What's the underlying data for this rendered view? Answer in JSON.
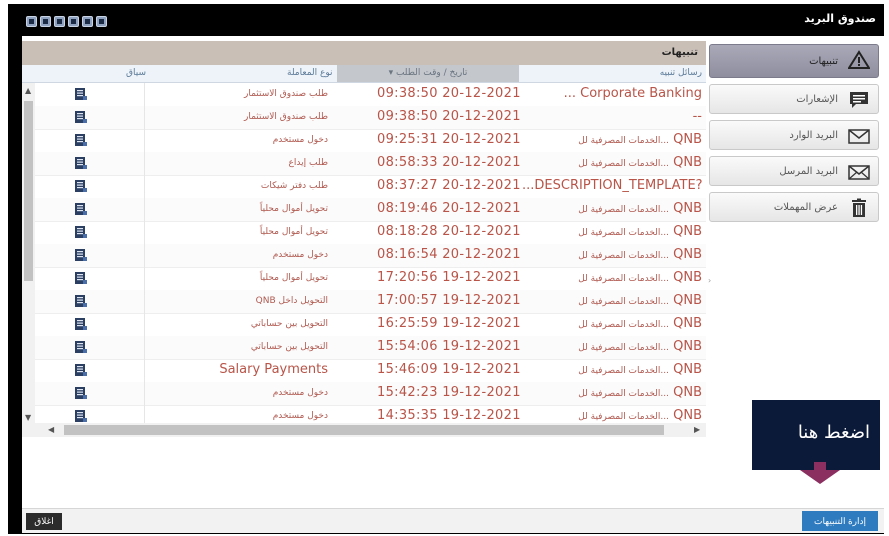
{
  "window": {
    "title": "صندوق البريد",
    "toolbar_icons": [
      "close-icon",
      "print-icon",
      "refresh-icon",
      "calculator-icon",
      "help-icon",
      "settings-icon"
    ]
  },
  "sidebar": {
    "items": [
      {
        "label": "تنبيهات",
        "icon": "warning-icon",
        "active": true
      },
      {
        "label": "الإشعارات",
        "icon": "speech-bubble-icon",
        "active": false
      },
      {
        "label": "البريد الوارد",
        "icon": "envelope-icon",
        "active": false
      },
      {
        "label": "البريد المرسل",
        "icon": "envelope-send-icon",
        "active": false
      },
      {
        "label": "عرض المهملات",
        "icon": "trash-icon",
        "active": false
      }
    ]
  },
  "panel": {
    "title": "تنبيهات",
    "columns": {
      "message": "رسائل تنبيه",
      "date": "تاريخ / وقت الطلب",
      "type": "نوع المعاملة",
      "context": "سياق"
    },
    "rows": [
      {
        "message": "Corporate Banking",
        "message_prefix": "...",
        "message_ar": "",
        "date": "09:38:50 20-12-2021",
        "type": "طلب صندوق الاستثمار",
        "type_big": false
      },
      {
        "message": "--",
        "message_prefix": "",
        "message_ar": "",
        "date": "09:38:50 20-12-2021",
        "type": "طلب صندوق الاستثمار",
        "type_big": false
      },
      {
        "message": "QNB",
        "message_prefix": "",
        "message_ar": "الخدمات المصرفية لل...",
        "date": "09:25:31 20-12-2021",
        "type": "دخول مستخدم",
        "type_big": false
      },
      {
        "message": "QNB",
        "message_prefix": "",
        "message_ar": "الخدمات المصرفية لل...",
        "date": "08:58:33 20-12-2021",
        "type": "طلب إيداع",
        "type_big": false
      },
      {
        "message": "...DESCRIPTION_TEMPLATE?",
        "message_prefix": "",
        "message_ar": "",
        "date": "08:37:27 20-12-2021",
        "type": "طلب دفتر شيكات",
        "type_big": false
      },
      {
        "message": "QNB",
        "message_prefix": "",
        "message_ar": "الخدمات المصرفية لل...",
        "date": "08:19:46 20-12-2021",
        "type": "تحويل أموال محلياً",
        "type_big": false
      },
      {
        "message": "QNB",
        "message_prefix": "",
        "message_ar": "الخدمات المصرفية لل...",
        "date": "08:18:28 20-12-2021",
        "type": "تحويل أموال محلياً",
        "type_big": false
      },
      {
        "message": "QNB",
        "message_prefix": "",
        "message_ar": "الخدمات المصرفية لل...",
        "date": "08:16:54 20-12-2021",
        "type": "دخول مستخدم",
        "type_big": false
      },
      {
        "message": "QNB",
        "message_prefix": "",
        "message_ar": "الخدمات المصرفية لل...",
        "date": "17:20:56 19-12-2021",
        "type": "تحويل أموال محلياً",
        "type_big": false
      },
      {
        "message": "QNB",
        "message_prefix": "",
        "message_ar": "الخدمات المصرفية لل...",
        "date": "17:00:57 19-12-2021",
        "type": "التحويل داخل QNB",
        "type_big": false
      },
      {
        "message": "QNB",
        "message_prefix": "",
        "message_ar": "الخدمات المصرفية لل...",
        "date": "16:25:59 19-12-2021",
        "type": "التحويل بين حساباتي",
        "type_big": false
      },
      {
        "message": "QNB",
        "message_prefix": "",
        "message_ar": "الخدمات المصرفية لل...",
        "date": "15:54:06 19-12-2021",
        "type": "التحويل بين حساباتي",
        "type_big": false
      },
      {
        "message": "QNB",
        "message_prefix": "",
        "message_ar": "الخدمات المصرفية لل...",
        "date": "15:46:09 19-12-2021",
        "type": "Salary Payments",
        "type_big": true
      },
      {
        "message": "QNB",
        "message_prefix": "",
        "message_ar": "الخدمات المصرفية لل...",
        "date": "15:42:23 19-12-2021",
        "type": "دخول مستخدم",
        "type_big": false
      },
      {
        "message": "QNB",
        "message_prefix": "",
        "message_ar": "الخدمات المصرفية لل...",
        "date": "14:35:35 19-12-2021",
        "type": "دخول مستخدم",
        "type_big": false
      }
    ]
  },
  "footer": {
    "close_label": "اغلاق",
    "manage_label": "إدارة التنبيهات"
  },
  "callout": {
    "text": "اضغط هنا"
  },
  "colors": {
    "accent_red": "#b85448",
    "header_bg": "#c9bfb7",
    "manage_button": "#2e7bbf",
    "callout_bg": "#0c1a3a",
    "arrow": "#8a2f5f"
  }
}
